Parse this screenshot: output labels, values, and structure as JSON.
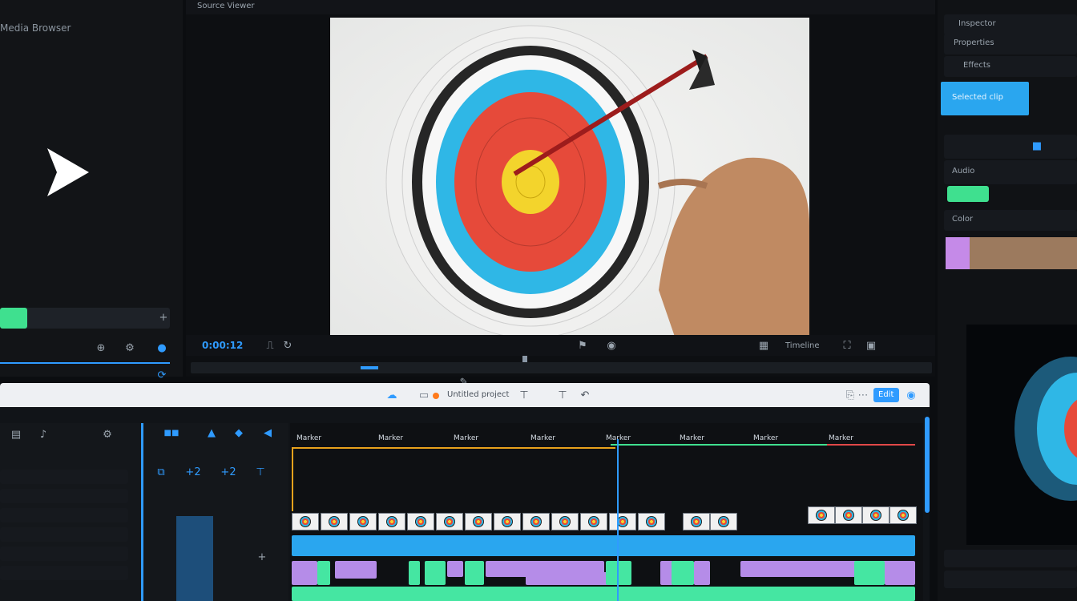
{
  "viewer": {
    "timecode": "0:00:12",
    "controls_label": "Timeline"
  },
  "timeline": {
    "toolbar_title": "Untitled project",
    "export_label": "Edit",
    "markers": [
      "Marker",
      "Marker",
      "Marker",
      "Marker",
      "Marker",
      "Marker",
      "Marker",
      "Marker"
    ]
  },
  "right_panel": {
    "rows": [
      "Inspector",
      "Properties",
      "Effects",
      "Audio",
      "Color"
    ],
    "blue_button": "Selected clip"
  },
  "colors": {
    "accent_blue": "#2f9bff",
    "accent_green": "#3fe08f",
    "accent_violet": "#c58ae8",
    "clip_blue": "#2aa6ef",
    "clip_green": "#45e6a2",
    "playhead": "#2f9bff"
  },
  "progress": {
    "left_slider": 0.16
  }
}
